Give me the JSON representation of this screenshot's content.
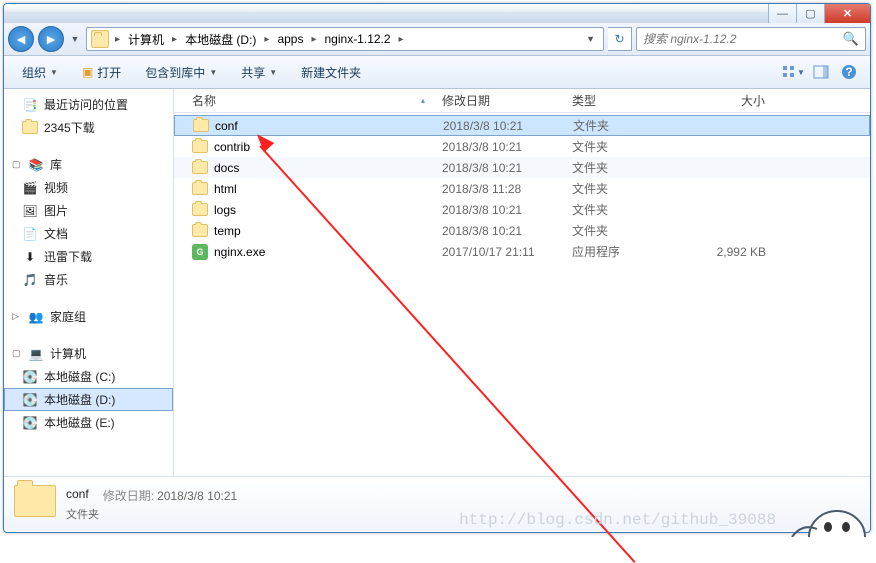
{
  "window_controls": {
    "min": "—",
    "max": "▢",
    "close": "✕"
  },
  "breadcrumb": {
    "items": [
      "计算机",
      "本地磁盘 (D:)",
      "apps",
      "nginx-1.12.2"
    ]
  },
  "search": {
    "placeholder": "搜索 nginx-1.12.2"
  },
  "toolbar": {
    "organize": "组织",
    "open": "打开",
    "include": "包含到库中",
    "share": "共享",
    "new_folder": "新建文件夹"
  },
  "sidebar": {
    "recent": "最近访问的位置",
    "download2345": "2345下载",
    "library": "库",
    "videos": "视频",
    "pictures": "图片",
    "documents": "文档",
    "xunlei": "迅雷下载",
    "music": "音乐",
    "homegroup": "家庭组",
    "computer": "计算机",
    "disk_c": "本地磁盘 (C:)",
    "disk_d": "本地磁盘 (D:)",
    "disk_e": "本地磁盘 (E:)"
  },
  "columns": {
    "name": "名称",
    "date": "修改日期",
    "type": "类型",
    "size": "大小"
  },
  "files": [
    {
      "name": "conf",
      "date": "2018/3/8 10:21",
      "type": "文件夹",
      "size": "",
      "icon": "folder",
      "selected": true
    },
    {
      "name": "contrib",
      "date": "2018/3/8 10:21",
      "type": "文件夹",
      "size": "",
      "icon": "folder"
    },
    {
      "name": "docs",
      "date": "2018/3/8 10:21",
      "type": "文件夹",
      "size": "",
      "icon": "folder"
    },
    {
      "name": "html",
      "date": "2018/3/8 11:28",
      "type": "文件夹",
      "size": "",
      "icon": "folder"
    },
    {
      "name": "logs",
      "date": "2018/3/8 10:21",
      "type": "文件夹",
      "size": "",
      "icon": "folder"
    },
    {
      "name": "temp",
      "date": "2018/3/8 10:21",
      "type": "文件夹",
      "size": "",
      "icon": "folder"
    },
    {
      "name": "nginx.exe",
      "date": "2017/10/17 21:11",
      "type": "应用程序",
      "size": "2,992 KB",
      "icon": "exe"
    }
  ],
  "details": {
    "name": "conf",
    "date_label": "修改日期:",
    "date": "2018/3/8 10:21",
    "type": "文件夹"
  },
  "watermark": "http://blog.csdn.net/github_39088"
}
